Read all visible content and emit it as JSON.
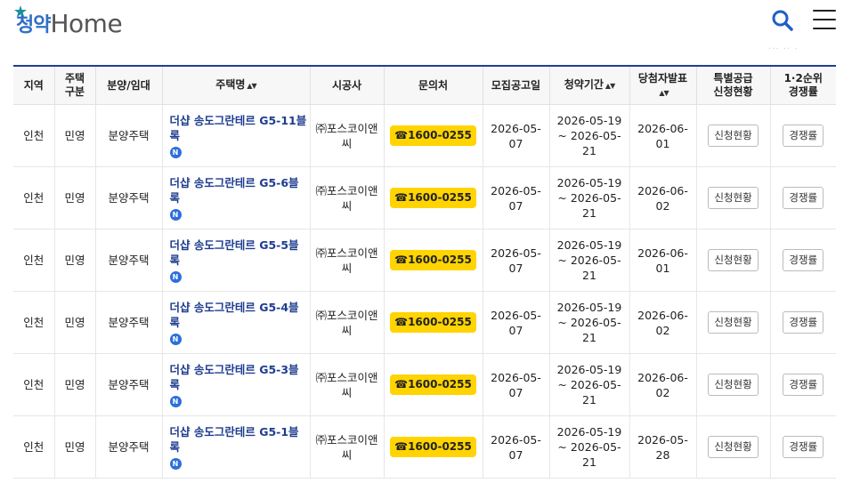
{
  "header": {
    "logo_ko": "청약",
    "logo_en": "Home",
    "faded_text": "··· ·· ·"
  },
  "table": {
    "headers": {
      "region": "지역",
      "house_type": "주택\n구분",
      "sale_type": "분양/임대",
      "house_name": "주택명",
      "builder": "시공사",
      "contact": "문의처",
      "notice_date": "모집공고일",
      "period": "청약기간",
      "winner_date": "당첨자발표",
      "special": "특별공급\n신청현황",
      "competition": "1·2순위\n경쟁률"
    },
    "rows": [
      {
        "region": "인천",
        "house_type": "민영",
        "sale_type": "분양주택",
        "name": "더샵 송도그란테르 G5-11블록",
        "badge": "N",
        "builder": "㈜포스코이앤씨",
        "phone": "☎1600-0255",
        "notice_date": "2026-05-07",
        "period": "2026-05-19 ~ 2026-05-21",
        "winner_date": "2026-06-01",
        "special_btn": "신청현황",
        "comp_btn": "경쟁률"
      },
      {
        "region": "인천",
        "house_type": "민영",
        "sale_type": "분양주택",
        "name": "더샵 송도그란테르 G5-6블록",
        "badge": "N",
        "builder": "㈜포스코이앤씨",
        "phone": "☎1600-0255",
        "notice_date": "2026-05-07",
        "period": "2026-05-19 ~ 2026-05-21",
        "winner_date": "2026-06-02",
        "special_btn": "신청현황",
        "comp_btn": "경쟁률"
      },
      {
        "region": "인천",
        "house_type": "민영",
        "sale_type": "분양주택",
        "name": "더샵 송도그란테르 G5-5블록",
        "badge": "N",
        "builder": "㈜포스코이앤씨",
        "phone": "☎1600-0255",
        "notice_date": "2026-05-07",
        "period": "2026-05-19 ~ 2026-05-21",
        "winner_date": "2026-06-01",
        "special_btn": "신청현황",
        "comp_btn": "경쟁률"
      },
      {
        "region": "인천",
        "house_type": "민영",
        "sale_type": "분양주택",
        "name": "더샵 송도그란테르 G5-4블록",
        "badge": "N",
        "builder": "㈜포스코이앤씨",
        "phone": "☎1600-0255",
        "notice_date": "2026-05-07",
        "period": "2026-05-19 ~ 2026-05-21",
        "winner_date": "2026-06-02",
        "special_btn": "신청현황",
        "comp_btn": "경쟁률"
      },
      {
        "region": "인천",
        "house_type": "민영",
        "sale_type": "분양주택",
        "name": "더샵 송도그란테르 G5-3블록",
        "badge": "N",
        "builder": "㈜포스코이앤씨",
        "phone": "☎1600-0255",
        "notice_date": "2026-05-07",
        "period": "2026-05-19 ~ 2026-05-21",
        "winner_date": "2026-06-02",
        "special_btn": "신청현황",
        "comp_btn": "경쟁률"
      },
      {
        "region": "인천",
        "house_type": "민영",
        "sale_type": "분양주택",
        "name": "더샵 송도그란테르 G5-1블록",
        "badge": "N",
        "builder": "㈜포스코이앤씨",
        "phone": "☎1600-0255",
        "notice_date": "2026-05-07",
        "period": "2026-05-19 ~ 2026-05-21",
        "winner_date": "2026-05-28",
        "special_btn": "신청현황",
        "comp_btn": "경쟁률"
      }
    ]
  },
  "colors": {
    "accent": "#1f3f8f",
    "link": "#1e3d8f",
    "phone_bg": "#ffd400",
    "badge": "#2c6fdc"
  }
}
